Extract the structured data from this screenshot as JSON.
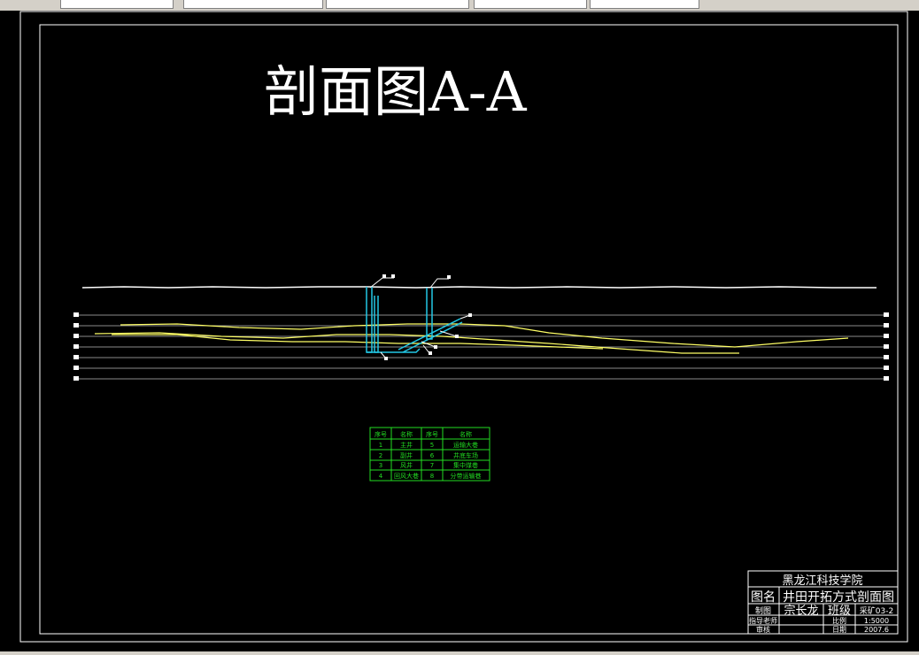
{
  "drawing": {
    "title": "剖面图A-A"
  },
  "legend_table": {
    "headers": [
      "序号",
      "名称",
      "序号",
      "名称"
    ],
    "rows": [
      [
        "1",
        "主井",
        "5",
        "运输大巷"
      ],
      [
        "2",
        "副井",
        "6",
        "井底车场"
      ],
      [
        "3",
        "风井",
        "7",
        "集中煤巷"
      ],
      [
        "4",
        "回风大巷",
        "8",
        "分带运输巷"
      ]
    ]
  },
  "title_block": {
    "school": "黑龙江科技学院",
    "name_label": "图名",
    "name_value": "井田开拓方式剖面图",
    "drawn_label": "制图",
    "author": "宗长龙",
    "class_label": "班级",
    "class_value": "采矿03-2",
    "teacher_label": "指导老师",
    "scale_label": "比例",
    "scale_value": "1:5000",
    "review_label": "审核",
    "date_label": "日期",
    "date_value": "2007.6"
  },
  "colors": {
    "background": "#000000",
    "frame": "#ffffff",
    "seam": "#ffff66",
    "shaft": "#22c8e6",
    "table": "#22dd22",
    "grid": "#8a8a8a"
  }
}
